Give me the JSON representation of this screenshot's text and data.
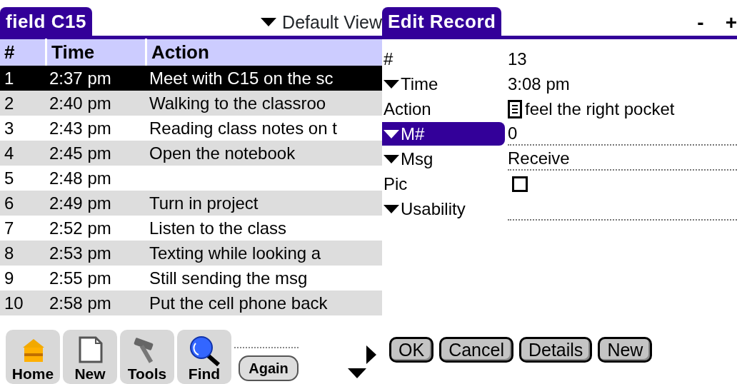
{
  "list_pane": {
    "title": "field C15",
    "view_selector": "Default View",
    "columns": [
      "#",
      "Time",
      "Action"
    ],
    "rows": [
      {
        "number": "1",
        "time": "2:37 pm",
        "action": "Meet with C15 on the sc",
        "selected": true
      },
      {
        "number": "2",
        "time": "2:40 pm",
        "action": "Walking to the classroo",
        "selected": false
      },
      {
        "number": "3",
        "time": "2:43 pm",
        "action": "Reading class notes on t",
        "selected": false
      },
      {
        "number": "4",
        "time": "2:45 pm",
        "action": "Open the notebook",
        "selected": false
      },
      {
        "number": "5",
        "time": "2:48 pm",
        "selected": false
      },
      {
        "number": "6",
        "time": "2:49 pm",
        "action": "Turn in project",
        "selected": false
      },
      {
        "number": "7",
        "time": "2:52 pm",
        "action": "Listen to the class",
        "selected": false
      },
      {
        "number": "8",
        "time": "2:53 pm",
        "action": "Texting while looking a",
        "selected": false
      },
      {
        "number": "9",
        "time": "2:55 pm",
        "action": "Still sending the msg",
        "selected": false
      },
      {
        "number": "10",
        "time": "2:58 pm",
        "action": "Put the cell phone back",
        "selected": false
      }
    ]
  },
  "toolbar": {
    "buttons": [
      {
        "label": "Home",
        "kind": "home"
      },
      {
        "label": "New",
        "kind": "new"
      },
      {
        "label": "Tools",
        "kind": "tools"
      },
      {
        "label": "Find",
        "kind": "find"
      }
    ],
    "again_button": "Again"
  },
  "edit_pane": {
    "title": "Edit Record",
    "zoom_out": "-",
    "zoom_in": "+",
    "fields": [
      {
        "label": "#",
        "kind": "text",
        "value": "13",
        "dropdown": false,
        "selected": false
      },
      {
        "label": "Time",
        "kind": "text",
        "value": "3:08 pm",
        "dropdown": true,
        "selected": false
      },
      {
        "label": "Action",
        "kind": "note",
        "value": "feel the right pocket",
        "dropdown": false,
        "selected": false
      },
      {
        "label": "M#",
        "kind": "field",
        "value": "0",
        "dropdown": true,
        "selected": true
      },
      {
        "label": "Msg",
        "kind": "field",
        "value": "Receive",
        "dropdown": true,
        "selected": false
      },
      {
        "label": "Pic",
        "kind": "checkbox",
        "checked": false,
        "dropdown": false,
        "selected": false
      },
      {
        "label": "Usability",
        "kind": "field",
        "dropdown": true,
        "selected": false
      }
    ],
    "buttons": [
      "OK",
      "Cancel",
      "Details",
      "New"
    ]
  }
}
